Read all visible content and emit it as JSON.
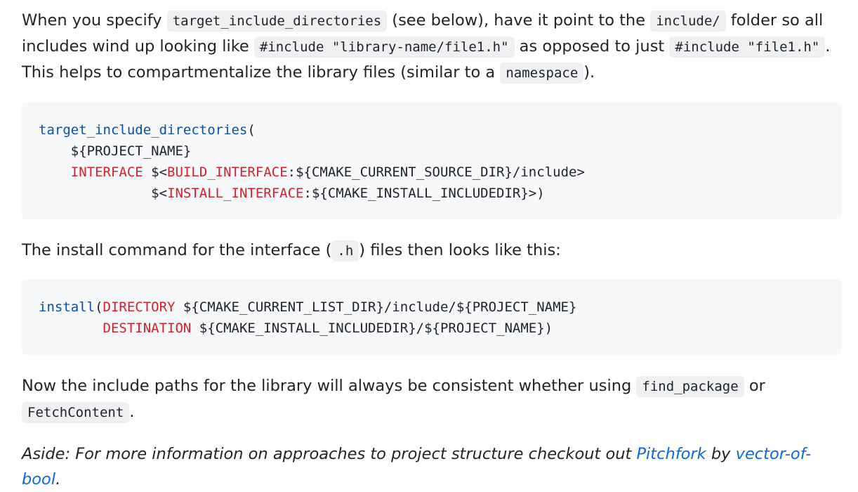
{
  "para1": {
    "t1": "When you specify ",
    "c1": "target_include_directories",
    "t2": " (see below), have it point to the ",
    "c2": "include/",
    "t3": " folder so all includes wind up looking like ",
    "c3": "#include \"library-name/file1.h\"",
    "t4": " as opposed to just ",
    "c4": "#include \"file1.h\"",
    "t5": ". This helps to compartmentalize the library files (similar to a ",
    "c5": "namespace",
    "t6": ")."
  },
  "code1": {
    "fn": "target_include_directories",
    "l1_rest": "(",
    "l2": "    ${PROJECT_NAME}",
    "l3_indent": "    ",
    "kw_interface": "INTERFACE",
    "l3_mid": " $<",
    "kw_build": "BUILD_INTERFACE",
    "l3_rest": ":${CMAKE_CURRENT_SOURCE_DIR}/include>",
    "l4_indent": "              $<",
    "kw_install": "INSTALL_INTERFACE",
    "l4_rest": ":${CMAKE_INSTALL_INCLUDEDIR}>)"
  },
  "para2": {
    "t1": "The install command for the interface (",
    "c1": ".h",
    "t2": ") files then looks like this:"
  },
  "code2": {
    "fn": "install",
    "l1_open": "(",
    "kw_directory": "DIRECTORY",
    "l1_rest": " ${CMAKE_CURRENT_LIST_DIR}/include/${PROJECT_NAME}",
    "l2_indent": "        ",
    "kw_destination": "DESTINATION",
    "l2_rest": " ${CMAKE_INSTALL_INCLUDEDIR}/${PROJECT_NAME})"
  },
  "para3": {
    "t1": "Now the include paths for the library will always be consistent whether using ",
    "c1": "find_package",
    "t2": " or ",
    "c2": "FetchContent",
    "t3": "."
  },
  "para4": {
    "t1": "Aside: For more information on approaches to project structure checkout out ",
    "link1": "Pitchfork",
    "t2": " by ",
    "link2": "vector-of-bool",
    "t3": "."
  }
}
